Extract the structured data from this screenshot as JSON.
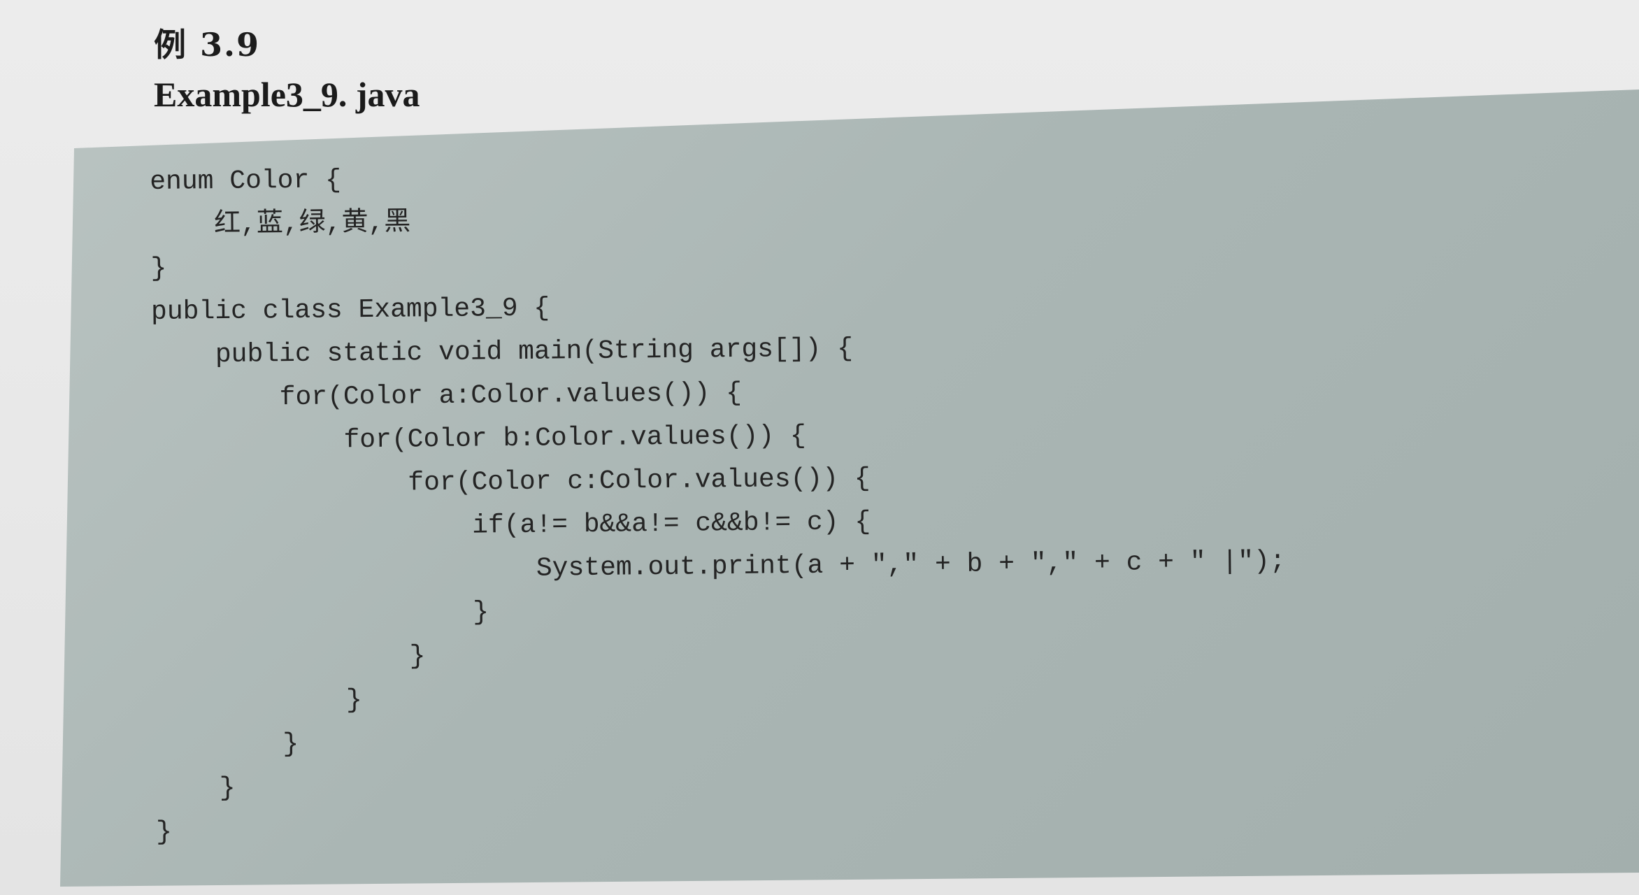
{
  "header": {
    "example_number": "例 3.9",
    "file_name": "Example3_9. java"
  },
  "code": {
    "lines": [
      "enum Color {",
      "    红,蓝,绿,黄,黑",
      "}",
      "public class Example3_9 {",
      "    public static void main(String args[]) {",
      "        for(Color a:Color.values()) {",
      "            for(Color b:Color.values()) {",
      "                for(Color c:Color.values()) {",
      "                    if(a!= b&&a!= c&&b!= c) {",
      "                        System.out.print(a + \",\" + b + \",\" + c + \" |\");",
      "                    }",
      "                }",
      "            }",
      "        }",
      "    }",
      "}"
    ]
  }
}
